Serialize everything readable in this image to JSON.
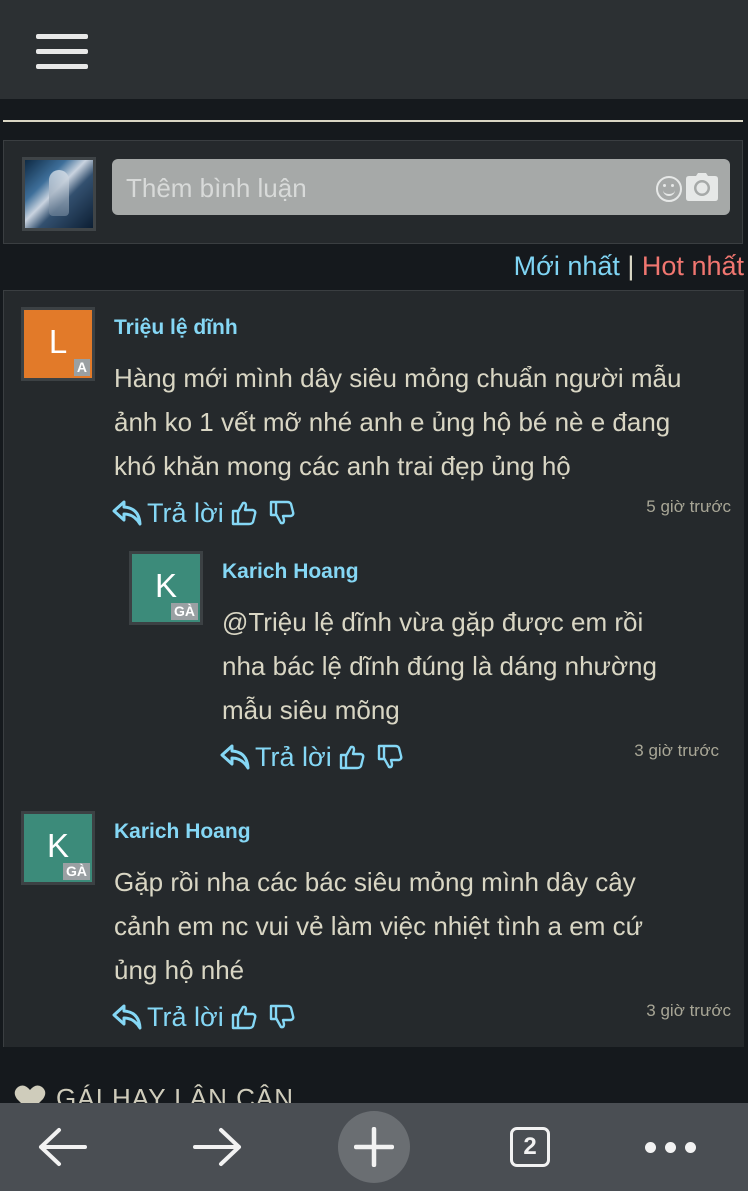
{
  "comment_input": {
    "placeholder": "Thêm bình luận"
  },
  "sort": {
    "newest": "Mới nhất",
    "separator": "|",
    "hot": "Hot nhất"
  },
  "reply_label": "Trả lời",
  "comments": [
    {
      "avatar_letter": "L",
      "avatar_badge": "A",
      "author": "Triệu lệ dĩnh",
      "lines": [
        "Hàng mới mình dây siêu mỏng chuẩn người mẫu",
        "ảnh ko 1 vết mỡ nhé anh e ủng hộ bé nè e đang",
        "khó khăn mong các anh trai đẹp ủng hộ"
      ],
      "time": "5 giờ trước"
    },
    {
      "avatar_letter": "K",
      "avatar_badge": "GÀ",
      "author": "Karich Hoang",
      "lines": [
        "@Triệu lệ dĩnh vừa gặp được em rồi",
        "nha bác lệ dĩnh đúng là dáng nhường",
        "mẫu siêu mõng"
      ],
      "time": "3 giờ trước"
    },
    {
      "avatar_letter": "K",
      "avatar_badge": "GÀ",
      "author": "Karich Hoang",
      "lines": [
        "Gặp rồi nha các bác siêu mỏng mình dây cây",
        "cảnh em nc vui vẻ làm việc nhiệt tình a em cứ",
        "ủng hộ nhé"
      ],
      "time": "3 giờ trước"
    }
  ],
  "section_heading": "GÁI HAY LÂN CẬN",
  "browser_nav": {
    "tab_count": "2"
  },
  "colors": {
    "link": "#85d7f5",
    "hot": "#f07670",
    "text": "#d9d6c4"
  }
}
